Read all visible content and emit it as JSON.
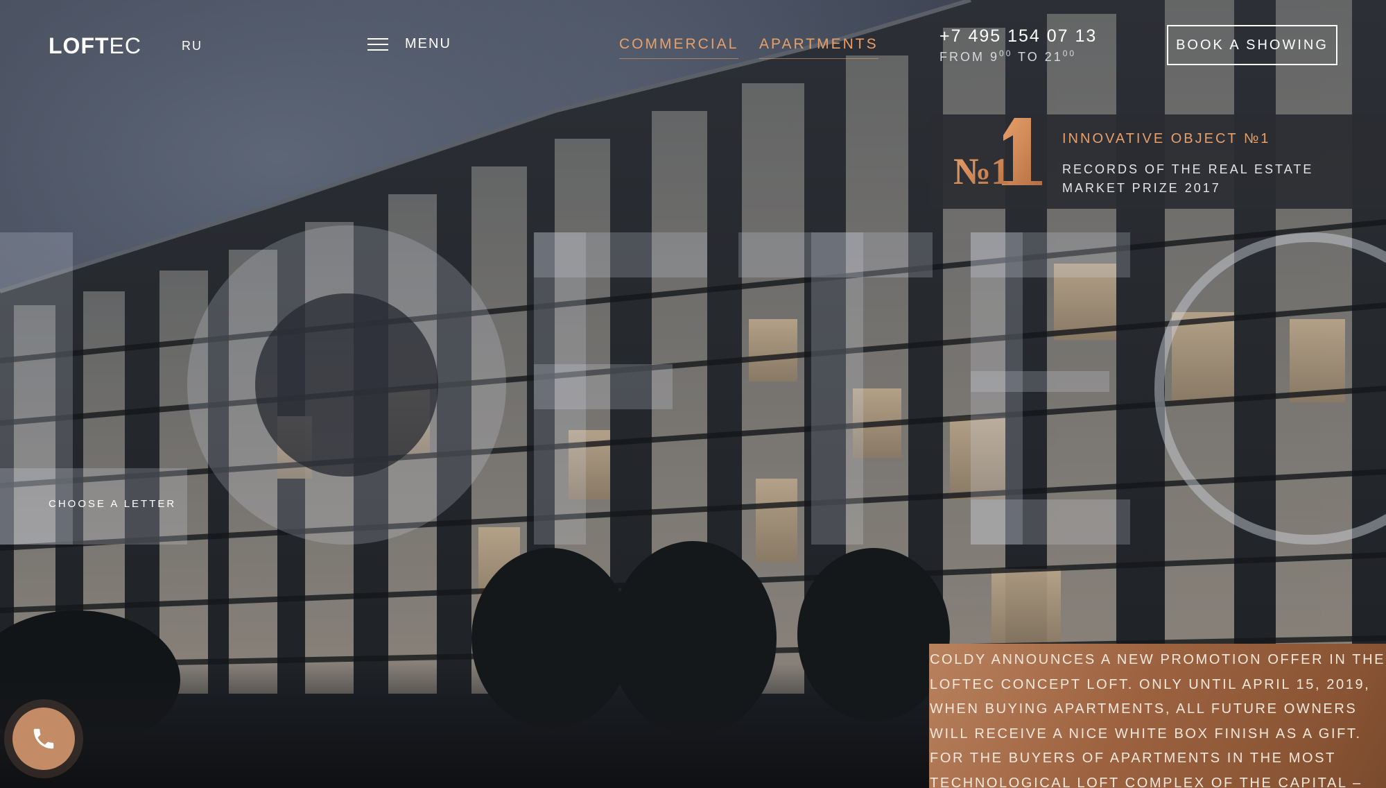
{
  "header": {
    "logo_bold": "LOFT",
    "logo_light": "EC",
    "language": "RU",
    "menu_label": "MENU",
    "nav": [
      {
        "label": "COMMERCIAL"
      },
      {
        "label": "APARTMENTS"
      }
    ],
    "phone": "+7 495 154 07 13",
    "hours": {
      "from": "FROM 9",
      "from_sup": "00",
      "to": " TO 21",
      "to_sup": "00"
    },
    "book_label": "BOOK A SHOWING"
  },
  "award": {
    "badge_text": "№1",
    "title": "INNOVATIVE OBJECT №1",
    "text": "RECORDS OF THE REAL ESTATE MARKET PRIZE 2017"
  },
  "hero": {
    "choose_letter": "CHOOSE A LETTER"
  },
  "promo": {
    "text": "COLDY ANNOUNCES A NEW PROMOTION OFFER IN THE LOFTEC CONCEPT LOFT. ONLY UNTIL APRIL 15, 2019, WHEN BUYING APARTMENTS, ALL FUTURE OWNERS WILL RECEIVE A NICE WHITE BOX FINISH AS A GIFT.\nFOR THE BUYERS OF APARTMENTS IN THE MOST TECHNOLOGICAL LOFT COMPLEX OF THE CAPITAL –"
  },
  "colors": {
    "accent": "#e7a06a",
    "promo_bg": "#9c6240",
    "panel_bg": "#2a2c32"
  },
  "icons": [
    "hamburger-icon",
    "phone-icon",
    "award-number-one-icon"
  ]
}
